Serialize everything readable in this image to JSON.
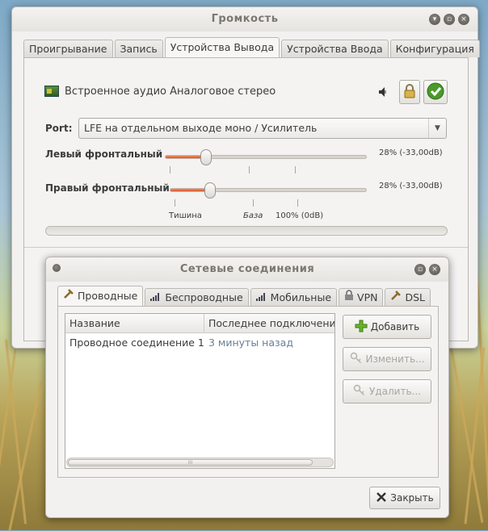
{
  "volume_window": {
    "title": "Громкость",
    "tabs": [
      "Проигрывание",
      "Запись",
      "Устройства Вывода",
      "Устройства Ввода",
      "Конфигурация"
    ],
    "device": {
      "name": "Встроенное аудио Аналоговое стерео"
    },
    "port": {
      "label": "Port:",
      "value": "LFE на отдельном выходе моно / Усилитель"
    },
    "channels": [
      {
        "label": "Левый фронтальный",
        "value_text": "28% (-33,00dB)",
        "level": 0.28
      },
      {
        "label": "Правый фронтальный",
        "value_text": "28% (-33,00dB)",
        "level": 0.28
      }
    ],
    "scale": {
      "silence": "Тишина",
      "base": "База",
      "full": "100% (0dB)"
    }
  },
  "network_window": {
    "title": "Сетевые соединения",
    "tabs": [
      "Проводные",
      "Беспроводные",
      "Мобильные",
      "VPN",
      "DSL"
    ],
    "columns": [
      "Название",
      "Последнее подключени"
    ],
    "rows": [
      {
        "name": "Проводное соединение 1",
        "last": "3 минуты назад"
      }
    ],
    "scroll_grip": "III",
    "buttons": {
      "add": "Добавить",
      "edit": "Изменить...",
      "delete": "Удалить...",
      "close": "Закрыть"
    }
  },
  "colors": {
    "accent": "#e0532a",
    "window_bg": "#f2f1f0"
  }
}
